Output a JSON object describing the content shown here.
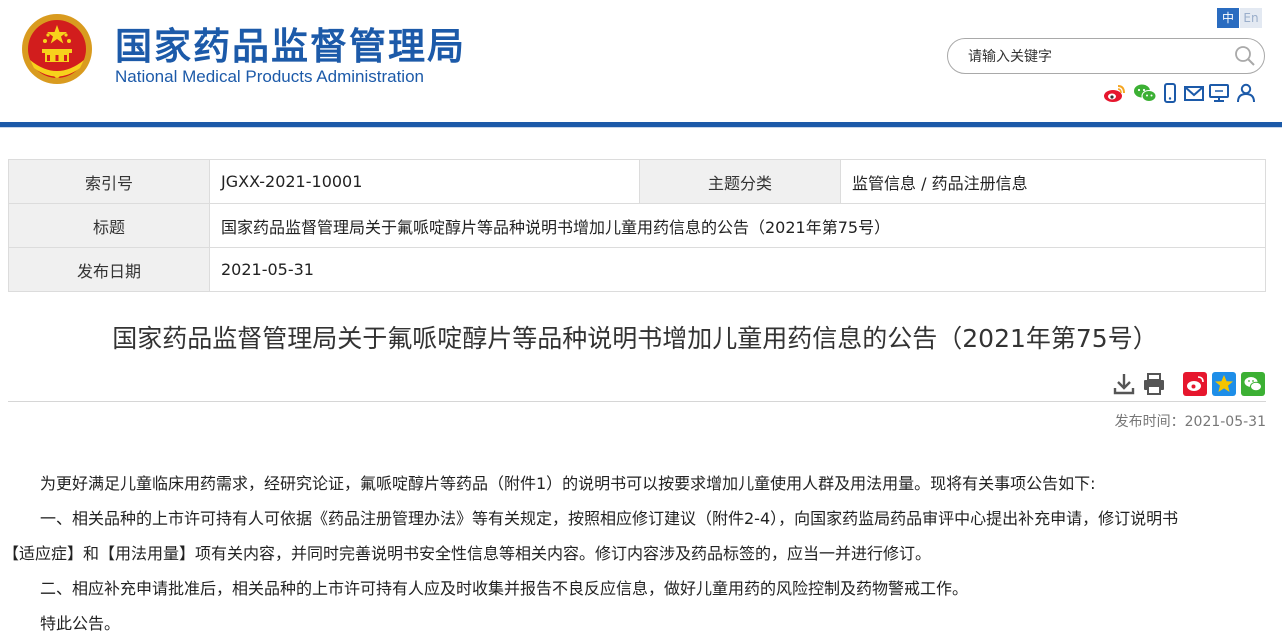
{
  "header": {
    "site_name_cn": "国家药品监督管理局",
    "site_name_en": "National Medical Products Administration",
    "lang_cn": "中",
    "lang_en": "En",
    "search_placeholder": "请输入关键字",
    "social_icons": [
      "weibo-icon",
      "wechat-icon",
      "mobile-icon",
      "mail-icon",
      "monitor-icon",
      "user-icon"
    ]
  },
  "meta": {
    "index_label": "索引号",
    "index_value": "JGXX-2021-10001",
    "category_label": "主题分类",
    "category_value": "监管信息 / 药品注册信息",
    "title_label": "标题",
    "title_value": "国家药品监督管理局关于氟哌啶醇片等品种说明书增加儿童用药信息的公告（2021年第75号）",
    "date_label": "发布日期",
    "date_value": "2021-05-31"
  },
  "article": {
    "title": "国家药品监督管理局关于氟哌啶醇片等品种说明书增加儿童用药信息的公告（2021年第75号）",
    "publish_time": "发布时间：2021-05-31",
    "paragraphs": [
      "为更好满足儿童临床用药需求，经研究论证，氟哌啶醇片等药品（附件1）的说明书可以按要求增加儿童使用人群及用法用量。现将有关事项公告如下:",
      "一、相关品种的上市许可持有人可依据《药品注册管理办法》等有关规定，按照相应修订建议（附件2-4），向国家药监局药品审评中心提出补充申请，修订说明书",
      "【适应症】和【用法用量】项有关内容，并同时完善说明书安全性信息等相关内容。修订内容涉及药品标签的，应当一并进行修订。",
      "二、相应补充申请批准后，相关品种的上市许可持有人应及时收集并报告不良反应信息，做好儿童用药的风险控制及药物警戒工作。",
      "特此公告。"
    ]
  },
  "colors": {
    "brand_blue": "#1c5aa9",
    "weibo_red": "#e6162d",
    "wechat_green": "#3cb034",
    "qzone_gold": "#f5b800"
  }
}
